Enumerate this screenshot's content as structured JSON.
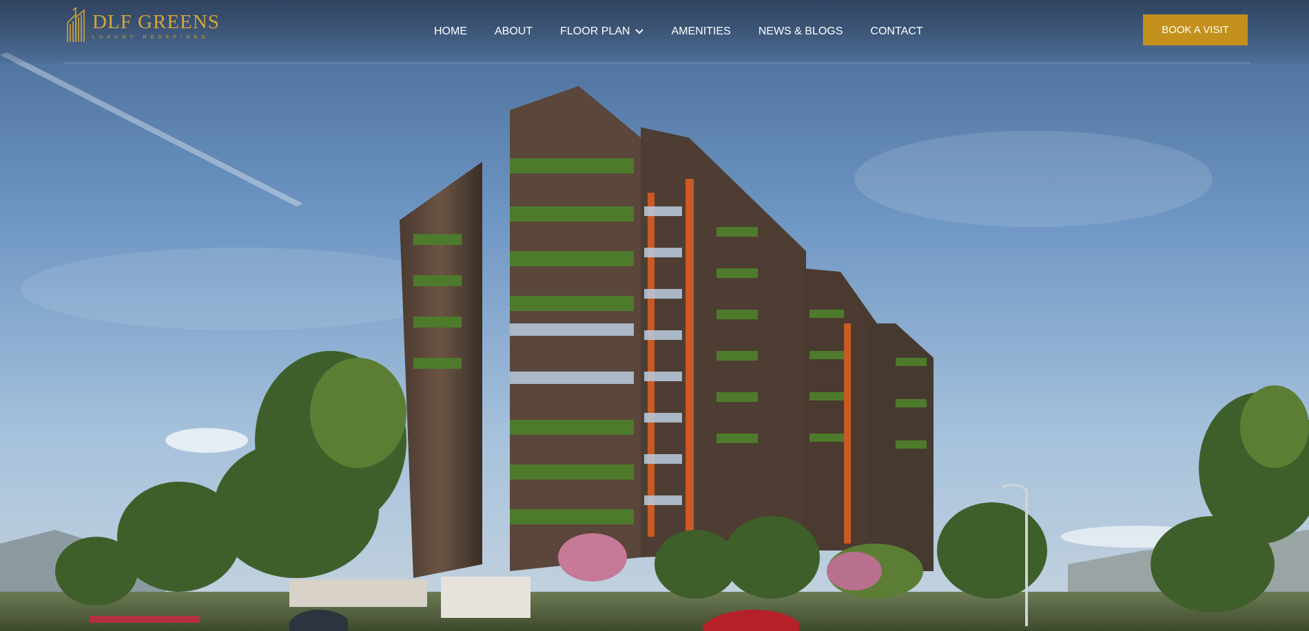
{
  "brand": {
    "name": "DLF GREENS",
    "tagline": "LUXURY REDEFINED",
    "color": "#d4a53a"
  },
  "nav": {
    "items": [
      {
        "label": "HOME"
      },
      {
        "label": "ABOUT"
      },
      {
        "label": "FLOOR PLAN",
        "icon": "chevron-down-icon"
      },
      {
        "label": "AMENITIES"
      },
      {
        "label": "NEWS & BLOGS"
      },
      {
        "label": "CONTACT"
      }
    ]
  },
  "cta": {
    "label": "BOOK A VISIT",
    "color": "#c4901c"
  },
  "hero": {
    "image": "architectural-rendering-residential-tower"
  }
}
